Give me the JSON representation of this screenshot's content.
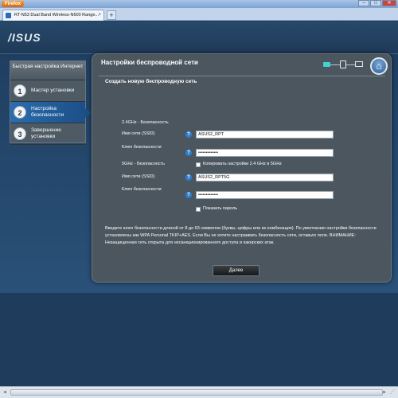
{
  "browser": {
    "app_button": "Firefox",
    "tab_title": "RT-N53 Dual Band Wireless-N600 Range...",
    "new_tab": "+",
    "win_min": "–",
    "win_max": "□",
    "win_close": "✕"
  },
  "header": {
    "logo": "/ISUS"
  },
  "sidebar": {
    "title": "Быстрая настройка Интернет",
    "items": [
      {
        "num": "1",
        "label": "Мастер установки"
      },
      {
        "num": "2",
        "label": "Настройка безопасности"
      },
      {
        "num": "3",
        "label": "Завершение установки"
      }
    ]
  },
  "panel": {
    "title": "Настройки беспроводной сети",
    "subtitle": "Создать новую беспроводную сеть",
    "home_icon": "⌂",
    "band24": {
      "label": "2.4GHz - Безопасность",
      "ssid_label": "Имя сети (SSID)",
      "ssid_value": "ASUS2_RPT",
      "key_label": "Ключ безопасности",
      "key_value": "•••••••••••••"
    },
    "band5": {
      "label": "5GHz - Безопасность",
      "copy_label": "Копировать настройки 2.4 GHz в 5GHz",
      "ssid_label": "Имя сети (SSID)",
      "ssid_value": "ASUS2_RPT5G",
      "key_label": "Ключ безопасности",
      "key_value": "•••••••••••••"
    },
    "show_password": "Показать пароль",
    "help_glyph": "?",
    "description": "Введите ключ безопасности длиной от 8 до 63 символов (буквы, цифры или их комбинация). По умолчанию настройки безопасности установлены как WPA Personal TKIP+AES. Если Вы не хотите настраивать безопасность сети, оставьте поле. ВНИМАНИЕ: Незащищенная сеть открыта для несанкционированного доступа и хакерских атак.",
    "next_button": "Далее"
  },
  "statusbar": {
    "left_arrow": "◂",
    "right_arrow": "▸",
    "grip": "⋰"
  },
  "colors": {
    "panel": "#4b565f",
    "accent": "#2e7fd1",
    "background": "#203c5c"
  }
}
